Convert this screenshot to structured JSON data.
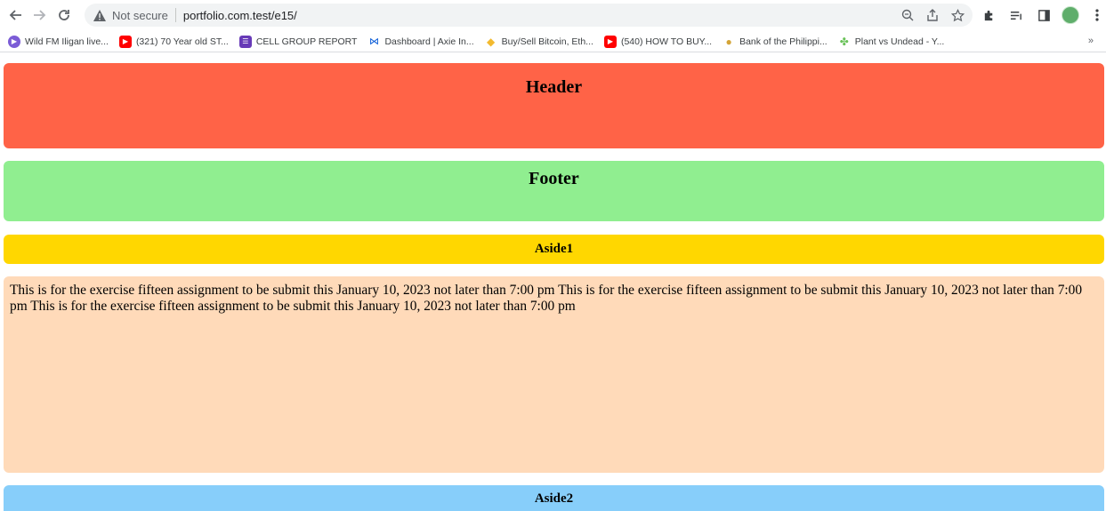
{
  "browser": {
    "security_label": "Not secure",
    "url": "portfolio.com.test/e15/"
  },
  "bookmarks": [
    {
      "label": "Wild FM Iligan live...",
      "icon": "play-icon",
      "color": "#7b5cd6"
    },
    {
      "label": "(321) 70 Year old ST...",
      "icon": "youtube-icon",
      "color": "#ff0000"
    },
    {
      "label": "CELL GROUP REPORT",
      "icon": "list-icon",
      "color": "#673ab7"
    },
    {
      "label": "Dashboard | Axie In...",
      "icon": "axie-icon",
      "color": "#0055d5"
    },
    {
      "label": "Buy/Sell Bitcoin, Eth...",
      "icon": "binance-icon",
      "color": "#f3ba2f"
    },
    {
      "label": "(540) HOW TO BUY...",
      "icon": "youtube-icon",
      "color": "#ff0000"
    },
    {
      "label": "Bank of the Philippi...",
      "icon": "bank-icon",
      "color": "#d4a437"
    },
    {
      "label": "Plant vs Undead - Y...",
      "icon": "plant-icon",
      "color": "#6ac259"
    }
  ],
  "page": {
    "header": "Header",
    "footer": "Footer",
    "aside1": "Aside1",
    "main_text": "This is for the exercise fifteen assignment to be submit this January 10, 2023 not later than 7:00 pm This is for the exercise fifteen assignment to be submit this January 10, 2023 not later than 7:00 pm This is for the exercise fifteen assignment to be submit this January 10, 2023 not later than 7:00 pm",
    "aside2": "Aside2"
  },
  "colors": {
    "header_bg": "#ff6347",
    "footer_bg": "#90ee90",
    "aside1_bg": "#ffd700",
    "main_bg": "#ffdab9",
    "aside2_bg": "#87cefa"
  }
}
